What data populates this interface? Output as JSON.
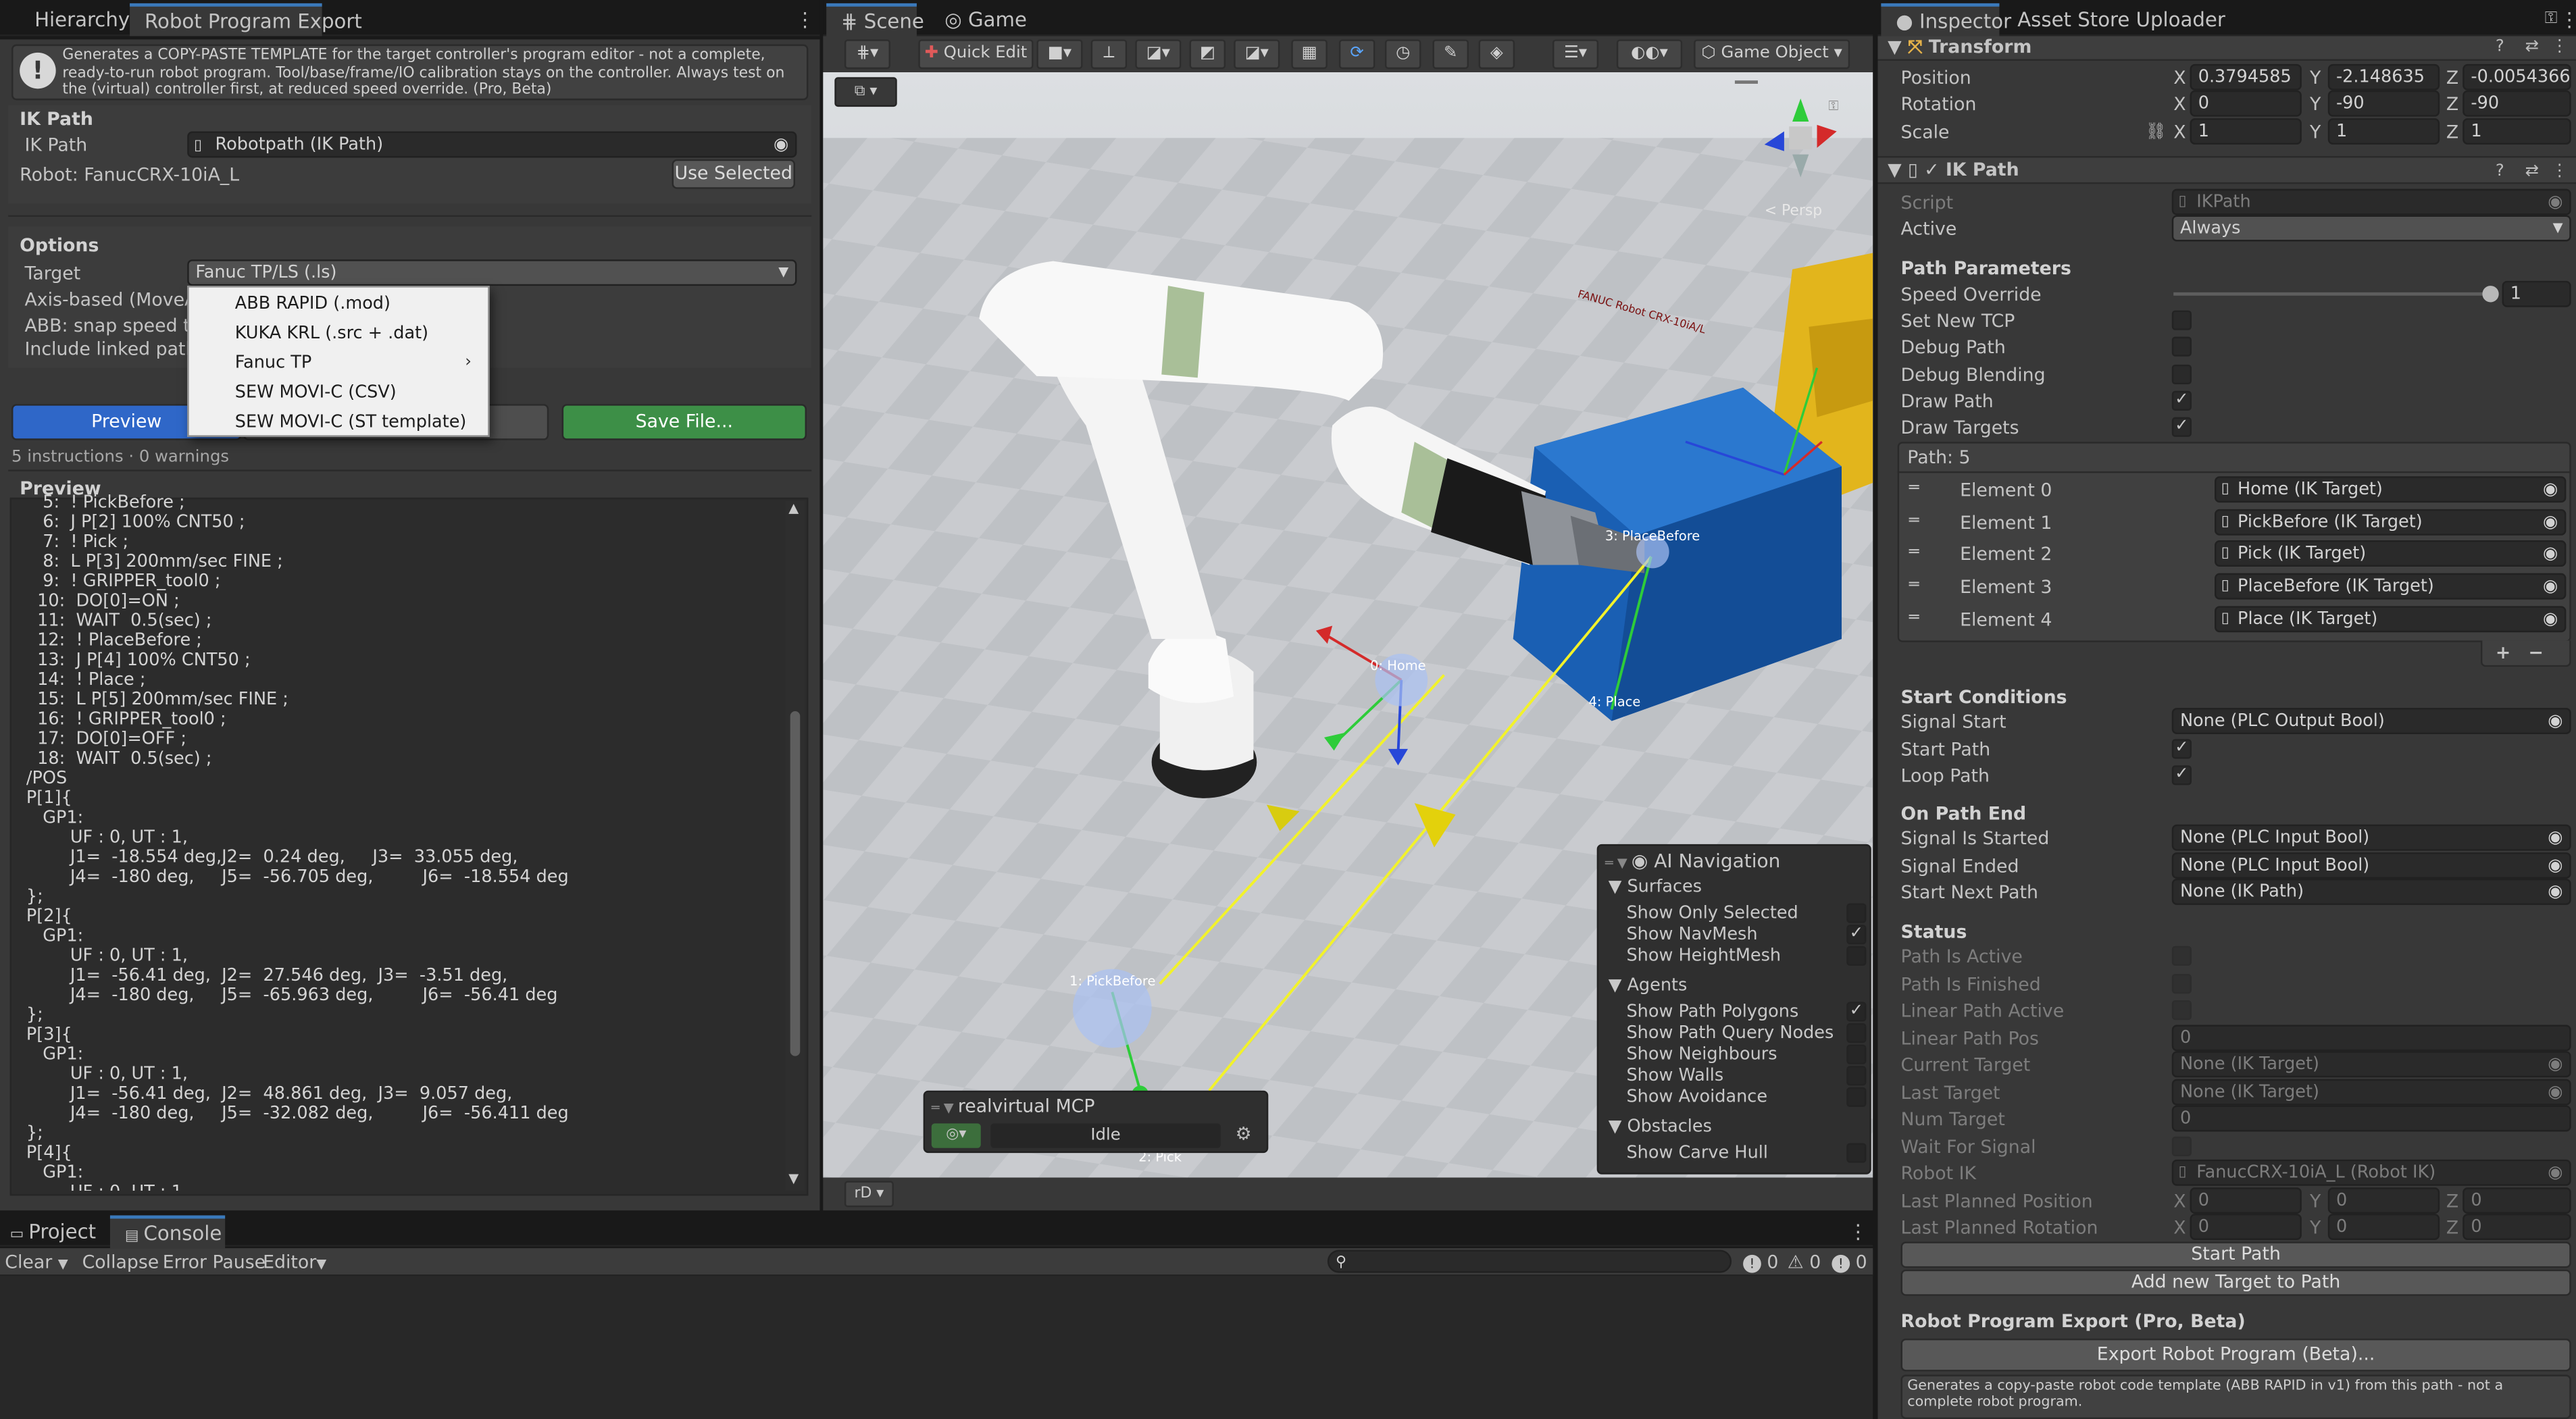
{
  "left_tabs": {
    "hierarchy": "Hierarchy",
    "export": "Robot Program Export"
  },
  "export": {
    "description": "Generates a COPY-PASTE TEMPLATE for the target controller's program editor - not a complete, ready-to-run robot program. Tool/base/frame/IO calibration stays on the controller. Always test on the (virtual) controller first, at reduced speed override. (Pro, Beta)",
    "ik_header": "IK Path",
    "ik_label": "IK Path",
    "ik_value": "Robotpath (IK Path)",
    "robot_text": "Robot: FanucCRX-10iA_L",
    "use_selected": "Use Selected",
    "options_header": "Options",
    "target_label": "Target",
    "target_value": "Fanuc TP/LS (.ls)",
    "axis_label": "Axis-based (MoveAbsJ)",
    "abb_label": "ABB: snap speed to predefined",
    "linked_label": "Include linked paths (",
    "menu": [
      "ABB RAPID (.mod)",
      "KUKA KRL (.src + .dat)",
      "Fanuc TP",
      "SEW MOVI-C (CSV)",
      "SEW MOVI-C (ST template)"
    ],
    "preview_button": "Preview",
    "save_button": "Save File...",
    "status": "5 instructions · 0 warnings",
    "preview_header": "Preview",
    "code": "   5:  ! PickBefore ;\n   6:  J P[2] 100% CNT50 ;\n   7:  ! Pick ;\n   8:  L P[3] 200mm/sec FINE ;\n   9:  ! GRIPPER_tool0 ;\n  10:  DO[0]=ON ;\n  11:  WAIT  0.5(sec) ;\n  12:  ! PlaceBefore ;\n  13:  J P[4] 100% CNT50 ;\n  14:  ! Place ;\n  15:  L P[5] 200mm/sec FINE ;\n  16:  ! GRIPPER_tool0 ;\n  17:  DO[0]=OFF ;\n  18:  WAIT  0.5(sec) ;\n/POS\nP[1]{\n   GP1:\n        UF : 0, UT : 1,\n        J1=  -18.554 deg,J2=  0.24 deg,     J3=  33.055 deg,\n        J4=  -180 deg,     J5=  -56.705 deg,         J6=  -18.554 deg\n};\nP[2]{\n   GP1:\n        UF : 0, UT : 1,\n        J1=  -56.41 deg,  J2=  27.546 deg,  J3=  -3.51 deg,\n        J4=  -180 deg,     J5=  -65.963 deg,         J6=  -56.41 deg\n};\nP[3]{\n   GP1:\n        UF : 0, UT : 1,\n        J1=  -56.41 deg,  J2=  48.861 deg,  J3=  9.057 deg,\n        J4=  -180 deg,     J5=  -32.082 deg,         J6=  -56.411 deg\n};\nP[4]{\n   GP1:\n        UF : 0, UT : 1"
  },
  "bottom": {
    "tabs": {
      "project": "Project",
      "console": "Console"
    },
    "clear": "Clear",
    "collapse": "Collapse",
    "error_pause": "Error Pause",
    "editor": "Editor",
    "count_info": "0",
    "count_warn": "0",
    "count_err": "0"
  },
  "scene": {
    "tabs": {
      "scene": "Scene",
      "game": "Game"
    },
    "quick_edit": "Quick Edit",
    "game_object": "Game Object",
    "persp": "< Persp",
    "labels": {
      "home": "0: Home",
      "pick_before": "1: PickBefore",
      "pick": "2: Pick",
      "place_before": "3: PlaceBefore",
      "place": "4: Place"
    },
    "robot_text": "FANUC Robot CRX-10iA/L",
    "mcp_title": "realvirtual MCP",
    "mcp_status": "Idle",
    "bottom_btn": "rD",
    "ai_nav": {
      "title": "AI Navigation",
      "surfaces": "Surfaces",
      "show_only_selected": "Show Only Selected",
      "show_navmesh": "Show NavMesh",
      "show_heightmesh": "Show HeightMesh",
      "agents": "Agents",
      "show_path_polygons": "Show Path Polygons",
      "show_path_query_nodes": "Show Path Query Nodes",
      "show_neighbours": "Show Neighbours",
      "show_walls": "Show Walls",
      "show_avoidance": "Show Avoidance",
      "obstacles": "Obstacles",
      "show_carve_hull": "Show Carve Hull"
    }
  },
  "inspector": {
    "tabs": {
      "inspector": "Inspector",
      "asset_store": "Asset Store Uploader"
    },
    "transform": {
      "title": "Transform",
      "position_label": "Position",
      "px": "0.3794585",
      "py": "-2.148635",
      "pz": "-0.00543662",
      "rotation_label": "Rotation",
      "rx": "0",
      "ry": "-90",
      "rz": "-90",
      "scale_label": "Scale",
      "sx": "1",
      "sy": "1",
      "sz": "1"
    },
    "ikpath": {
      "title": "IK Path",
      "script_label": "Script",
      "script_value": "IKPath",
      "active_label": "Active",
      "active_value": "Always",
      "path_params": "Path Parameters",
      "speed_override_label": "Speed Override",
      "speed_override_value": "1",
      "speed_override_fraction": 1.0,
      "set_new_tcp": "Set New TCP",
      "debug_path": "Debug Path",
      "debug_blending": "Debug Blending",
      "draw_path": "Draw Path",
      "draw_targets": "Draw Targets",
      "path_count": "Path: 5",
      "elements": [
        {
          "label": "Element 0",
          "value": "Home (IK Target)"
        },
        {
          "label": "Element 1",
          "value": "PickBefore (IK Target)"
        },
        {
          "label": "Element 2",
          "value": "Pick (IK Target)"
        },
        {
          "label": "Element 3",
          "value": "PlaceBefore (IK Target)"
        },
        {
          "label": "Element 4",
          "value": "Place (IK Target)"
        }
      ],
      "start_conditions": "Start Conditions",
      "signal_start_label": "Signal Start",
      "signal_start_value": "None (PLC Output Bool)",
      "start_path": "Start Path",
      "loop_path": "Loop Path",
      "on_path_end": "On Path End",
      "signal_is_started_label": "Signal Is Started",
      "signal_is_started_value": "None (PLC Input Bool)",
      "signal_ended_label": "Signal Ended",
      "signal_ended_value": "None (PLC Input Bool)",
      "start_next_path_label": "Start Next Path",
      "start_next_path_value": "None (IK Path)",
      "status": "Status",
      "path_is_active": "Path Is Active",
      "path_is_finished": "Path Is Finished",
      "linear_path_active": "Linear Path Active",
      "linear_path_pos_label": "Linear Path Pos",
      "linear_path_pos_value": "0",
      "current_target_label": "Current Target",
      "current_target_value": "None (IK Target)",
      "last_target_label": "Last Target",
      "last_target_value": "None (IK Target)",
      "num_target_label": "Num Target",
      "num_target_value": "0",
      "wait_for_signal": "Wait For Signal",
      "robot_ik_label": "Robot IK",
      "robot_ik_value": "FanucCRX-10iA_L (Robot IK)",
      "last_planned_position": "Last Planned Position",
      "last_planned_rotation": "Last Planned Rotation",
      "zero": "0",
      "start_path_button": "Start Path",
      "add_target_button": "Add new Target to Path",
      "rpe_header": "Robot Program Export (Pro, Beta)",
      "export_button": "Export Robot Program (Beta)...",
      "rpe_desc": "Generates a copy-paste robot code template (ABB RAPID in v1) from this path - not a complete robot program."
    },
    "axis": {
      "x": "X",
      "y": "Y",
      "z": "Z"
    }
  }
}
